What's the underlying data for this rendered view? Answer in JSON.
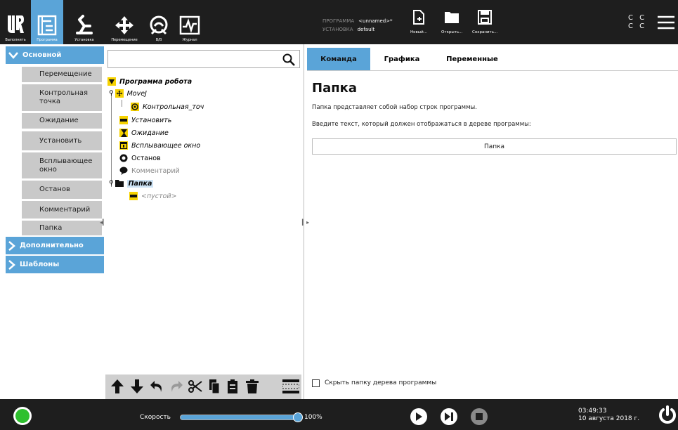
{
  "header": {
    "nav": [
      {
        "label": "Выполнить",
        "icon": "ur-logo-icon"
      },
      {
        "label": "Программа",
        "icon": "program-icon"
      },
      {
        "label": "Установка",
        "icon": "installation-icon"
      },
      {
        "label": "Перемещение",
        "icon": "move-icon"
      },
      {
        "label": "В/В",
        "icon": "io-icon"
      },
      {
        "label": "Журнал",
        "icon": "log-icon"
      }
    ],
    "program_label": "ПРОГРАММА",
    "program_value": "<unnamed>*",
    "installation_label": "УСТАНОВКА",
    "installation_value": "default",
    "new_label": "Новый...",
    "open_label": "Открыть...",
    "save_label": "Сохранить...",
    "cc_top": "C C",
    "cc_bottom": "C C"
  },
  "sidebar": {
    "basic": "Основной",
    "items": [
      "Перемещение",
      "Контрольная точка",
      "Ожидание",
      "Установить",
      "Всплывающее окно",
      "Останов",
      "Комментарий",
      "Папка"
    ],
    "advanced": "Дополнительно",
    "templates": "Шаблоны"
  },
  "tree": {
    "root": "Программа робота",
    "movej": "MoveJ",
    "waypoint": "Контрольная_точ",
    "set": "Установить",
    "wait": "Ожидание",
    "popup": "Всплывающее окно",
    "halt": "Останов",
    "comment": "Комментарий",
    "folder": "Папка",
    "empty": "<пустой>"
  },
  "tabs": {
    "command": "Команда",
    "graphics": "Графика",
    "variables": "Переменные"
  },
  "panel": {
    "title": "Папка",
    "desc": "Папка представляет собой набор строк программы.",
    "prompt": "Введите текст, который должен отображаться в дереве программы:",
    "field_value": "Папка",
    "hide_label": "Скрыть папку дерева программы"
  },
  "footer": {
    "speed_label": "Скорость",
    "speed_value": "100%",
    "speed_fraction": 1.0,
    "time": "03:49:33",
    "date": "10 августа 2018 г."
  },
  "colors": {
    "accent": "#5aa4d8",
    "dark": "#1e1e1e",
    "status_green": "#2ec02e",
    "sidebar_item": "#c9c9c9"
  }
}
